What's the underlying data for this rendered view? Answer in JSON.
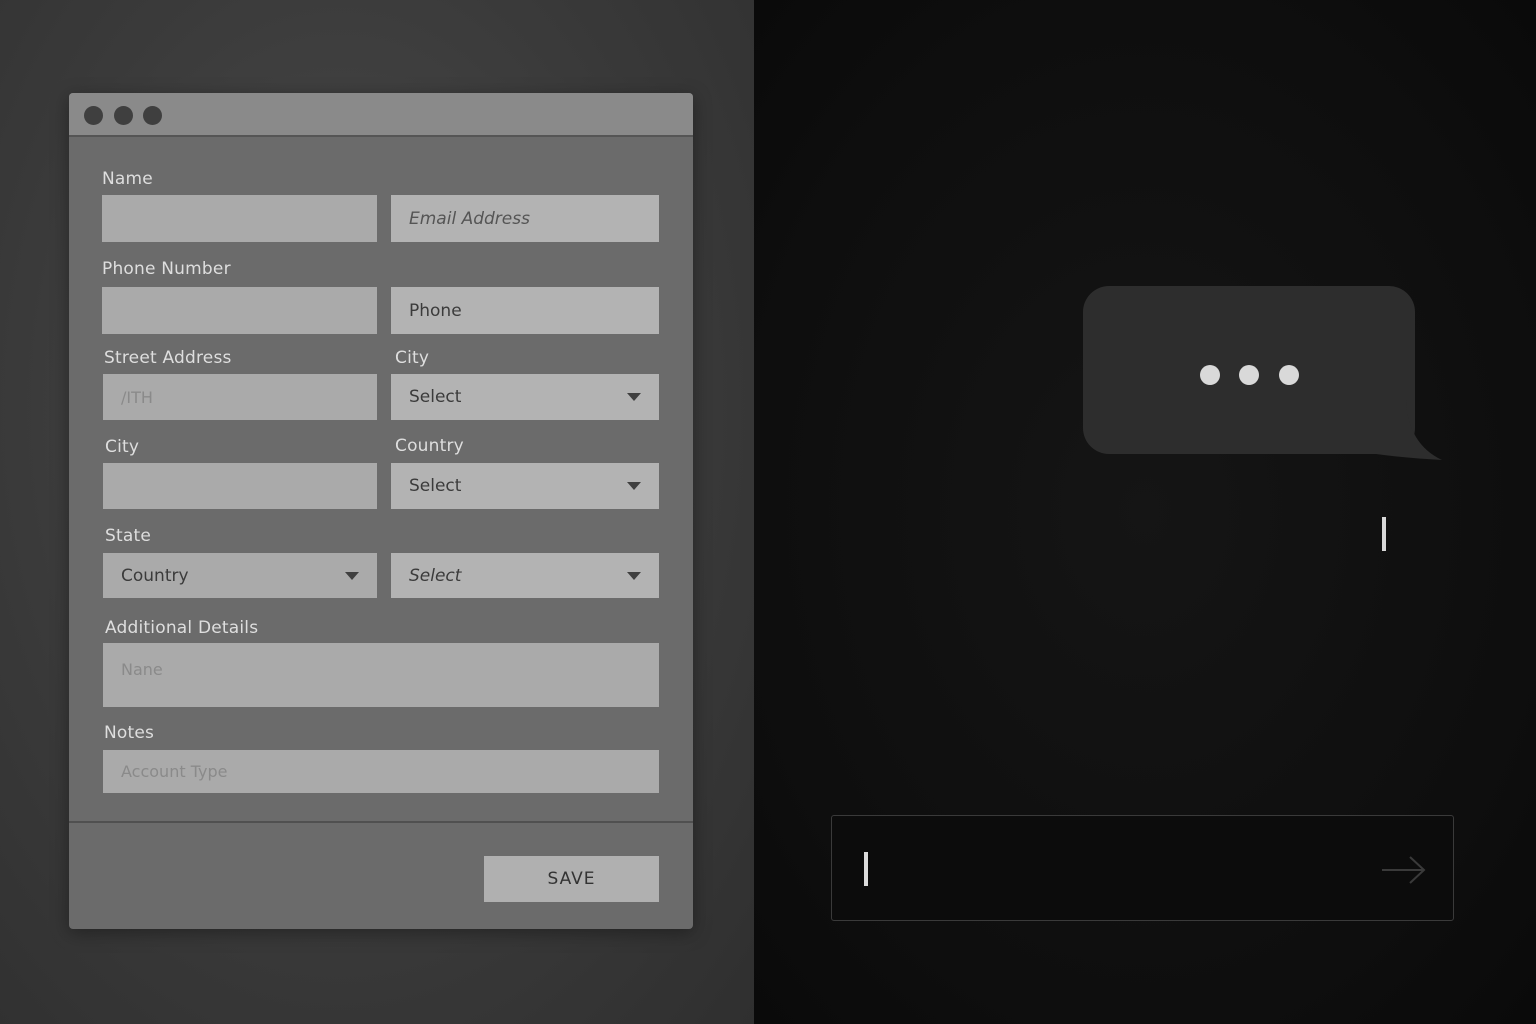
{
  "form": {
    "name_label": "Name",
    "name_value": "",
    "email_placeholder": "Email Address",
    "phone_number_label": "Phone Number",
    "phone_number_value": "",
    "phone_placeholder": "Phone",
    "street_address_label": "Street Address",
    "street_address_value": "/ITH",
    "city_label_right": "City",
    "city_select_value": "Select",
    "city_label_left": "City",
    "city_value": "",
    "country_label": "Country",
    "country_select_value": "Select",
    "state_label": "State",
    "state_select_value": "Country",
    "state_second_select_value": "Select",
    "additional_details_label": "Additional Details",
    "additional_details_placeholder": "Nane",
    "notes_label": "Notes",
    "notes_placeholder": "Account Type",
    "save_label": "SAVE"
  },
  "chat": {
    "typing_indicator": "typing-dots",
    "message_input_value": "",
    "send_icon": "arrow-right-icon"
  },
  "colors": {
    "left_background": "#3a3a3a",
    "window_body": "#6b6b6b",
    "field": "#aaaaaa",
    "right_background": "#0e0e0e",
    "bubble": "#2d2d2d"
  }
}
